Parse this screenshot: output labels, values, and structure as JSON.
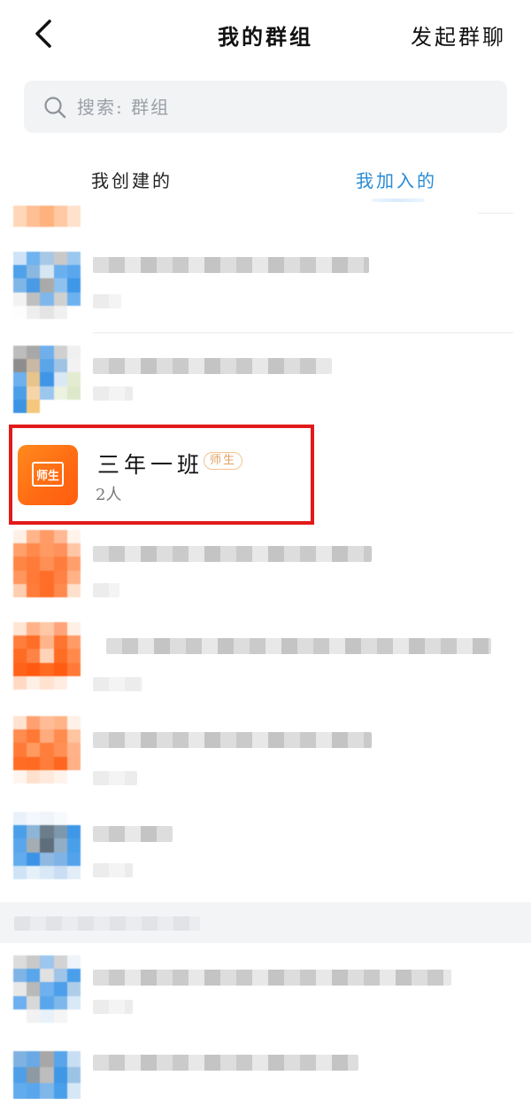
{
  "header": {
    "title": "我的群组",
    "action_label": "发起群聊"
  },
  "search": {
    "placeholder": "搜索: 群组"
  },
  "tabs": [
    {
      "label": "我创建的",
      "active": false
    },
    {
      "label": "我加入的",
      "active": true
    }
  ],
  "highlighted_group": {
    "avatar_label": "师生",
    "name": "三年一班",
    "tag": "师生",
    "member_count": "2人"
  },
  "colors": {
    "accent": "#2a8bd6",
    "avatar_orange": "#ff7a18",
    "highlight": "#e21a1a",
    "tag_text": "#e0a161"
  },
  "icons": {
    "back": "chevron-left-icon",
    "search": "search-icon",
    "book": "book-icon"
  }
}
